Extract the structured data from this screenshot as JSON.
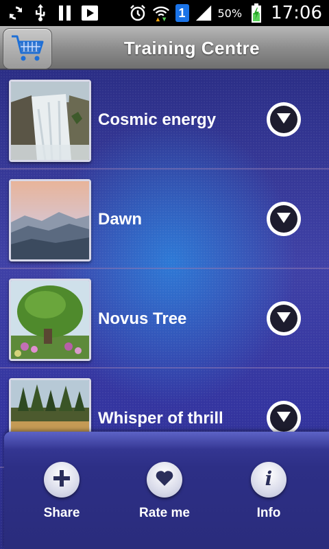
{
  "status_bar": {
    "battery": "50%",
    "time": "17:06",
    "sim_badge": "1",
    "icons": [
      "sync-icon",
      "usb-icon",
      "pause-icon",
      "play-icon",
      "alarm-icon",
      "wifi-icon",
      "sim-icon",
      "signal-icon",
      "battery-icon"
    ]
  },
  "header": {
    "title": "Training Centre",
    "cart_icon": "shopping-cart-icon"
  },
  "items": [
    {
      "label": "Cosmic energy",
      "image": "waterfall"
    },
    {
      "label": "Dawn",
      "image": "mountains-dawn"
    },
    {
      "label": "Novus Tree",
      "image": "topiary-tree"
    },
    {
      "label": "Whisper of thrill",
      "image": "forest-lake"
    }
  ],
  "bottom_bar": {
    "share": "Share",
    "rate": "Rate me",
    "info": "Info"
  },
  "colors": {
    "background": "#3435a0",
    "header": "#8e8e8e",
    "button_dark": "#1d1c2e"
  }
}
